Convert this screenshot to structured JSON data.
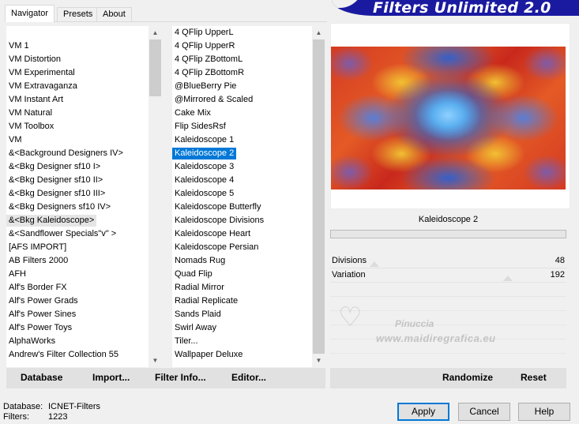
{
  "tabs": [
    "Navigator",
    "Presets",
    "About"
  ],
  "banner": {
    "title": "Filters Unlimited 2.0"
  },
  "categories": {
    "items": [
      "VM 1",
      "VM Distortion",
      "VM Experimental",
      "VM Extravaganza",
      "VM Instant Art",
      "VM Natural",
      "VM Toolbox",
      "VM",
      "&<Background Designers IV>",
      "&<Bkg Designer sf10 I>",
      "&<Bkg Designer sf10 II>",
      "&<Bkg Designer sf10 III>",
      "&<Bkg Designers sf10 IV>",
      "&<Bkg Kaleidoscope>",
      "&<Sandflower Specials\"v\" >",
      "[AFS IMPORT]",
      "AB Filters 2000",
      "AFH",
      "Alf's Border FX",
      "Alf's Power Grads",
      "Alf's Power Sines",
      "Alf's Power Toys",
      "AlphaWorks",
      "Andrew's Filter Collection 55"
    ],
    "highlighted": "&<Bkg Kaleidoscope>"
  },
  "filters": {
    "items": [
      "4 QFlip UpperL",
      "4 QFlip UpperR",
      "4 QFlip ZBottomL",
      "4 QFlip ZBottomR",
      "@BlueBerry Pie",
      "@Mirrored & Scaled",
      "Cake Mix",
      "Flip SidesRsf",
      "Kaleidoscope 1",
      "Kaleidoscope 2",
      "Kaleidoscope 3",
      "Kaleidoscope 4",
      "Kaleidoscope 5",
      "Kaleidoscope Butterfly",
      "Kaleidoscope Divisions",
      "Kaleidoscope Heart",
      "Kaleidoscope Persian",
      "Nomads Rug",
      "Quad Flip",
      "Radial Mirror",
      "Radial Replicate",
      "Sands Plaid",
      "Swirl Away",
      "Tiler...",
      "Wallpaper Deluxe"
    ],
    "selected": "Kaleidoscope 2"
  },
  "preview": {
    "filter_name": "Kaleidoscope 2",
    "params": [
      {
        "label": "Divisions",
        "value": "48",
        "fraction": 0.188
      },
      {
        "label": "Variation",
        "value": "192",
        "fraction": 0.753
      }
    ]
  },
  "watermark": {
    "name": "Pinuccia",
    "url": "www.maidiregrafica.eu"
  },
  "left_bar": {
    "database": "Database",
    "import": "Import...",
    "filter_info": "Filter Info...",
    "editor": "Editor..."
  },
  "right_bar": {
    "randomize": "Randomize",
    "reset": "Reset"
  },
  "status": {
    "database_label": "Database:",
    "database_value": "ICNET-Filters",
    "filters_label": "Filters:",
    "filters_value": "1223"
  },
  "buttons": {
    "apply": "Apply",
    "cancel": "Cancel",
    "help": "Help"
  }
}
